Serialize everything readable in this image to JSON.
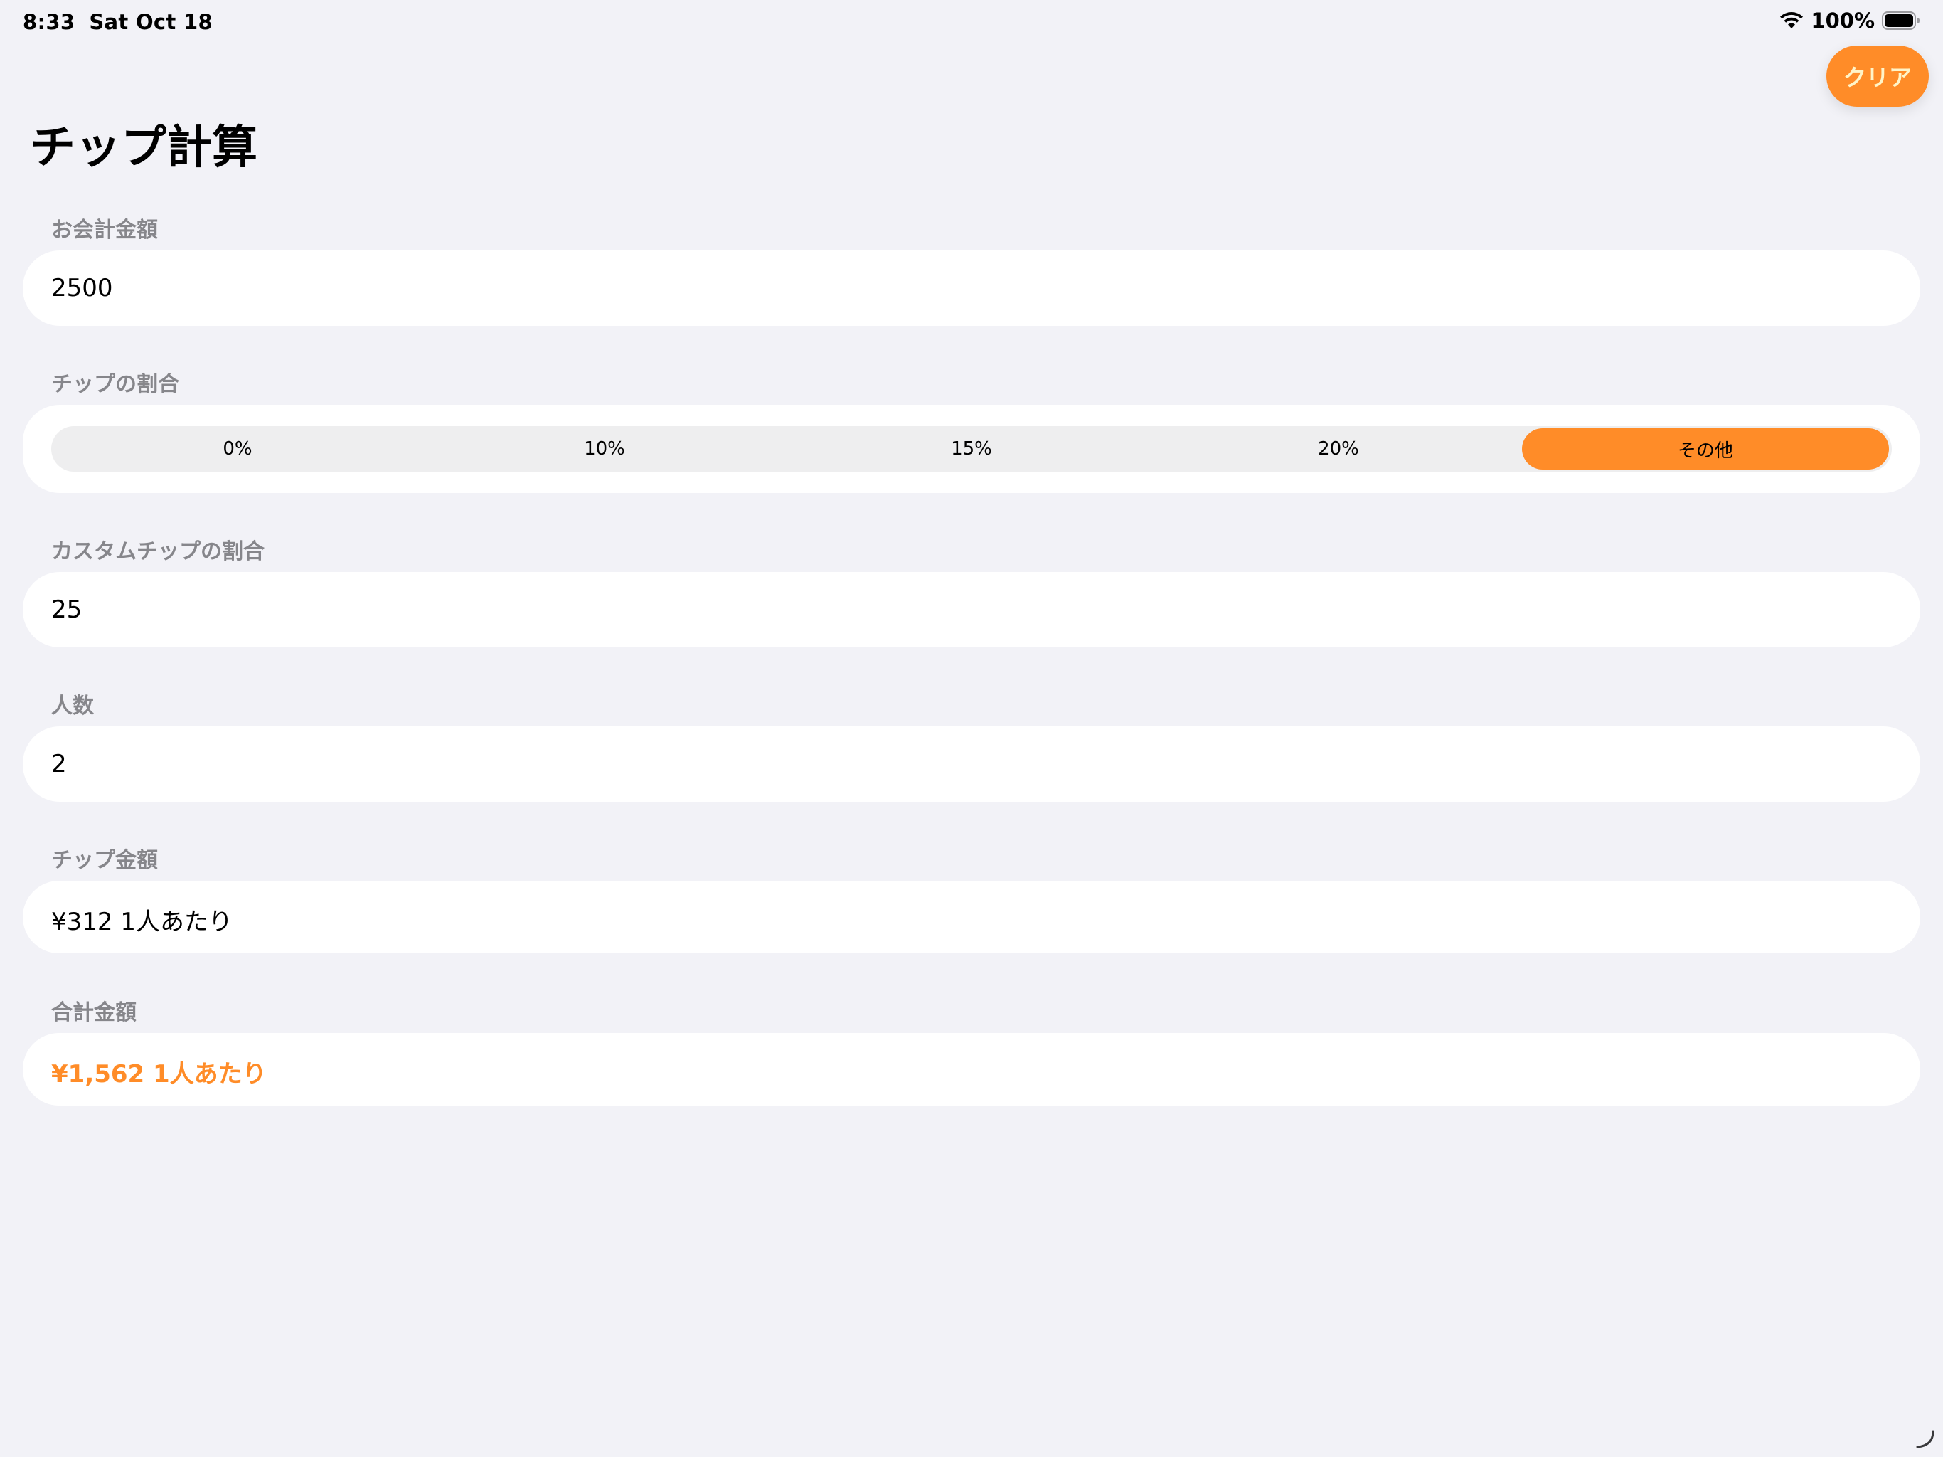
{
  "status_bar": {
    "time": "8:33",
    "date": "Sat Oct 18",
    "battery": "100%"
  },
  "header": {
    "clear_label": "クリア",
    "title": "チップ計算"
  },
  "bill": {
    "label": "お会計金額",
    "value": "2500"
  },
  "tip_percentage": {
    "label": "チップの割合",
    "options": [
      "0%",
      "10%",
      "15%",
      "20%",
      "その他"
    ],
    "selected": "その他"
  },
  "custom_tip": {
    "label": "カスタムチップの割合",
    "value": "25"
  },
  "people": {
    "label": "人数",
    "value": "2"
  },
  "tip_amount": {
    "label": "チップ金額",
    "value": "¥312 1人あたり"
  },
  "total": {
    "label": "合計金額",
    "value": "¥1,562 1人あたり"
  },
  "colors": {
    "accent": "#ff8c28",
    "background": "#f2f2f7",
    "card": "#ffffff",
    "label": "#86868b"
  }
}
